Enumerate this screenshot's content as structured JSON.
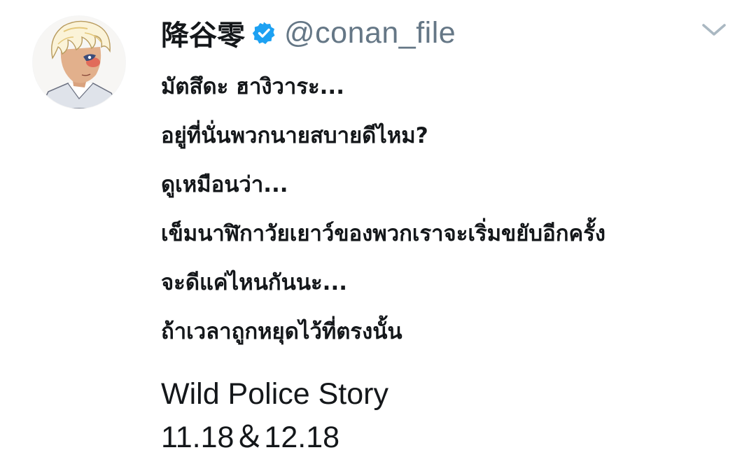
{
  "tweet": {
    "display_name": "降谷零",
    "verified": true,
    "handle": "@conan_file",
    "avatar": "anime-character-avatar",
    "menu_icon": "chevron-down-icon",
    "lines": [
      "มัตสึดะ ฮางิวาระ...",
      "อยู่ที่นั่นพวกนายสบายดีไหม?",
      "ดูเหมือนว่า...",
      "เข็มนาฬิกาวัยเยาว์ของพวกเราจะเริ่มขยับอีกครั้ง",
      "จะดีแค่ไหนกันนะ...",
      "ถ้าเวลาถูกหยุดไว้ที่ตรงนั้น"
    ],
    "footer_lines": [
      "Wild Police Story",
      "11.18＆12.18"
    ]
  },
  "colors": {
    "text": "#14171a",
    "secondary": "#657786",
    "verified": "#1da1f2",
    "chevron": "#aab8c2"
  }
}
